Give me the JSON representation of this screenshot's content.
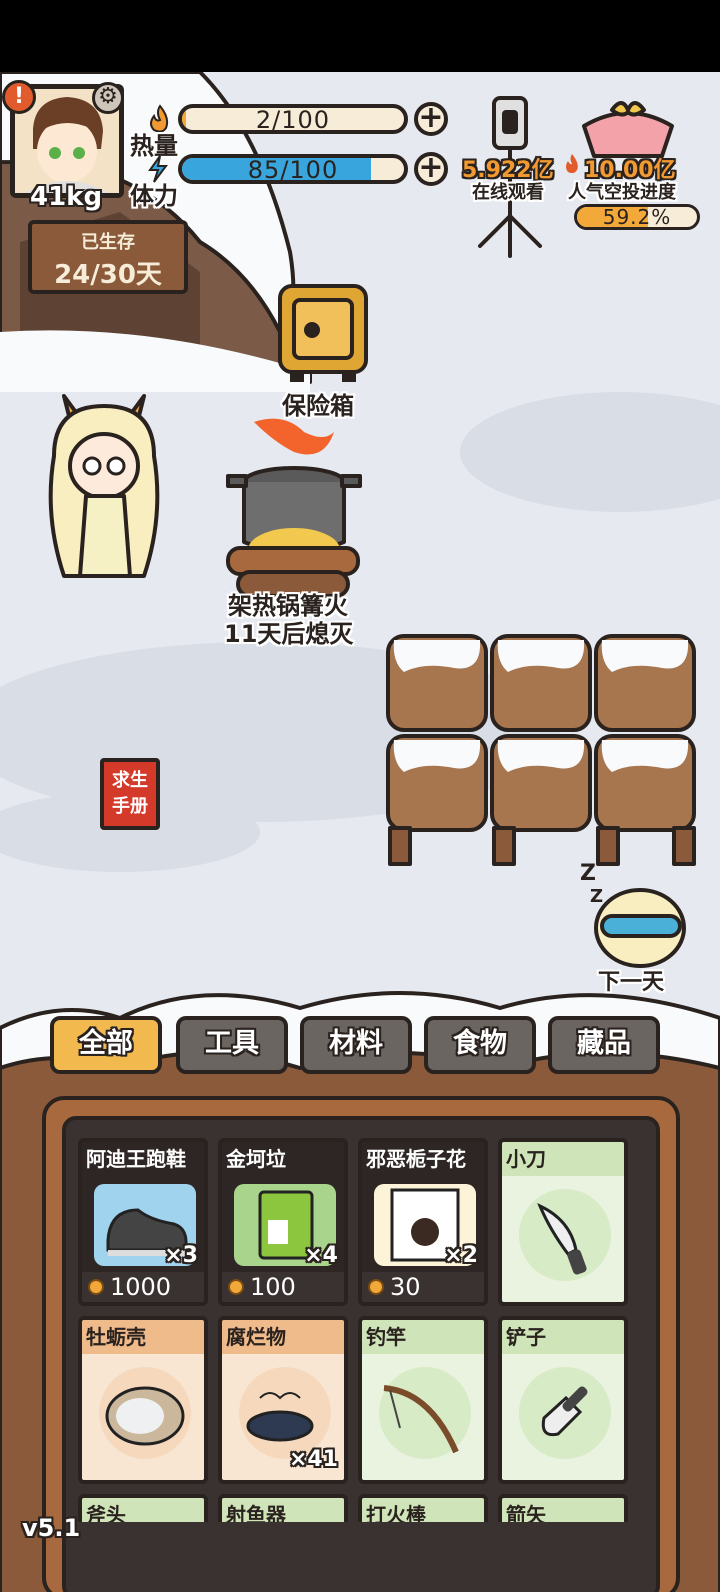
{
  "stats": {
    "weight": "41kg",
    "calories_label": "热量",
    "calories_value": "2/100",
    "calories_ratio": 0.02,
    "stamina_label": "体力",
    "stamina_value": "85/100",
    "stamina_ratio": 0.85
  },
  "survival": {
    "label": "已生存",
    "days": "24/30天"
  },
  "live": {
    "viewers": "5.922亿",
    "viewers_label": "在线观看",
    "popularity_target": "10.00亿",
    "airdrop_label": "人气空投进度",
    "airdrop_progress": "59.2%",
    "airdrop_ratio": 0.592
  },
  "scene": {
    "safe_label": "保险箱",
    "campfire_label": "架热锅篝火",
    "campfire_status": "11天后熄灭",
    "handbook_line1": "求生",
    "handbook_line2": "手册",
    "next_day_label": "下一天"
  },
  "tabs": [
    "全部",
    "工具",
    "材料",
    "食物",
    "藏品"
  ],
  "active_tab": "全部",
  "inventory": [
    {
      "name": "阿迪王跑鞋",
      "qty": "×3",
      "price": "1000",
      "style": "dark",
      "icon": "sneaker-icon"
    },
    {
      "name": "金坷垃",
      "qty": "×4",
      "price": "100",
      "style": "dark",
      "icon": "fertilizer-bag-icon"
    },
    {
      "name": "邪恶栀子花",
      "qty": "×2",
      "price": "30",
      "style": "dark",
      "icon": "book-icon"
    },
    {
      "name": "小刀",
      "qty": "",
      "price": "",
      "style": "green",
      "icon": "knife-icon"
    },
    {
      "name": "牡蛎壳",
      "qty": "",
      "price": "",
      "style": "orange",
      "icon": "oyster-shell-icon"
    },
    {
      "name": "腐烂物",
      "qty": "×41",
      "price": "",
      "style": "orange",
      "icon": "rotten-fish-icon"
    },
    {
      "name": "钓竿",
      "qty": "",
      "price": "",
      "style": "green",
      "icon": "fishing-rod-icon"
    },
    {
      "name": "铲子",
      "qty": "",
      "price": "",
      "style": "green",
      "icon": "shovel-icon"
    },
    {
      "name": "斧头",
      "qty": "",
      "price": "",
      "style": "green",
      "icon": "axe-icon"
    },
    {
      "name": "射鱼器",
      "qty": "",
      "price": "",
      "style": "green",
      "icon": "spear-gun-icon"
    },
    {
      "name": "打火棒",
      "qty": "",
      "price": "",
      "style": "green",
      "icon": "fire-starter-icon"
    },
    {
      "name": "箭矢",
      "qty": "",
      "price": "",
      "style": "green",
      "icon": "arrow-icon"
    }
  ],
  "version": "v5.1",
  "colors": {
    "stamina_bar": "#38a5dc",
    "progress_bar": "#f2a93a",
    "active_tab": "#f2b94e",
    "wood": "#8a5a3a"
  }
}
